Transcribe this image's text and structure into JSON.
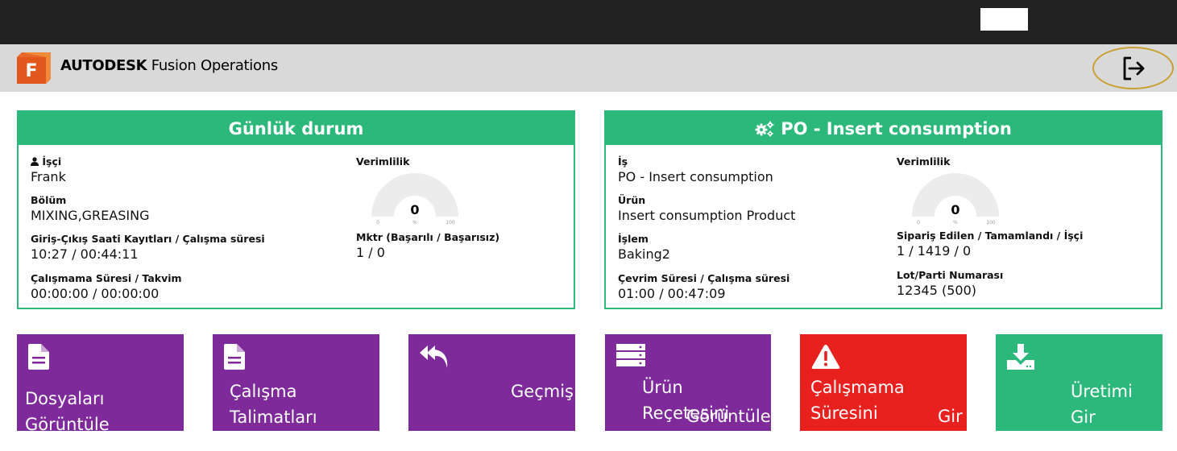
{
  "app": {
    "brand_bold": "AUTODESK",
    "brand_rest": " Fusion Operations",
    "logo_letter": "F"
  },
  "daily": {
    "title": "Günlük durum",
    "worker_label": "İşçi",
    "worker_value": "Frank",
    "dept_label": "Bölüm",
    "dept_value": "MIXING,GREASING",
    "inout_label": "Giriş-Çıkış Saati Kayıtları / Çalışma süresi",
    "inout_value": "10:27 / 00:44:11",
    "downtime_label": "Çalışmama Süresi / Takvim",
    "downtime_value": "00:00:00 / 00:00:00",
    "eff_label": "Verimlilik",
    "gauge_value": "0",
    "gauge_min": "0",
    "gauge_unit": "%",
    "gauge_max": "100",
    "gauge_level": 0,
    "qty_label": "Mktr (Başarılı / Başarısız)",
    "qty_value": "1 / 0"
  },
  "po": {
    "title": "PO - Insert consumption",
    "job_label": "İş",
    "job_value": "PO - Insert consumption",
    "product_label": "Ürün",
    "product_value": "Insert consumption Product",
    "op_label": "İşlem",
    "op_value": "Baking2",
    "cycle_label": "Çevrim Süresi / Çalışma süresi",
    "cycle_value": "01:00 / 00:47:09",
    "eff_label": "Verimlilik",
    "gauge_value": "0",
    "gauge_min": "0",
    "gauge_unit": "%",
    "gauge_max": "100",
    "gauge_level": 0,
    "order_label": "Sipariş Edilen / Tamamlandı / İşçi",
    "order_value": "1 / 1419 / 0",
    "lot_label": "Lot/Parti Numarası",
    "lot_value": "12345 (500)"
  },
  "tiles": {
    "files": "Dosyaları Görüntüle",
    "instructions": "Çalışma Talimatları",
    "history": "Geçmiş",
    "bom_line1": "Ürün Reçetesini",
    "bom_line2": "Görüntüle",
    "downtime_line1": "Çalışmama Süresini",
    "downtime_line2": "Gir",
    "production": "Üretimi Gir"
  },
  "colors": {
    "accent_green": "#2cb87a",
    "tile_purple": "#7f2a9a",
    "tile_red": "#e8211f",
    "logout_ring": "#c8a032"
  },
  "icons": [
    "logout-icon",
    "user-icon",
    "gears-icon",
    "file-icon",
    "reply-all-icon",
    "server-icon",
    "warning-icon",
    "download-icon"
  ]
}
